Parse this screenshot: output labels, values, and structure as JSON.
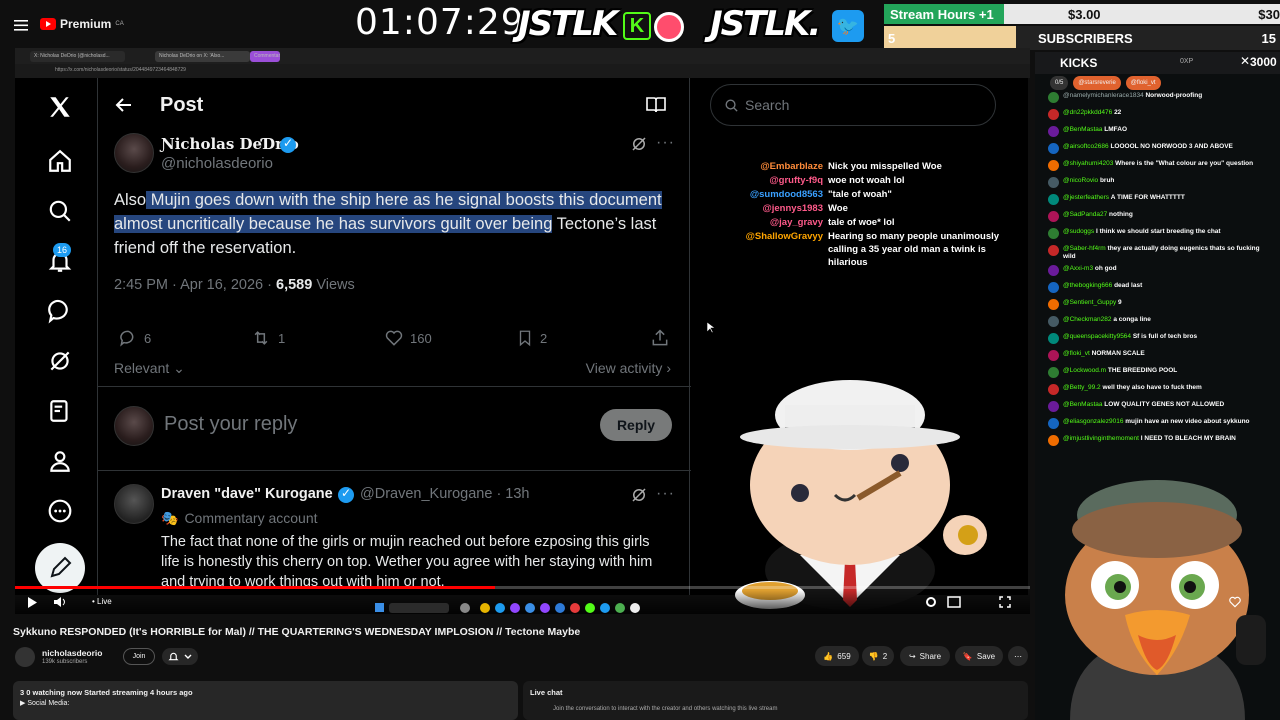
{
  "youtube": {
    "logo_text": "Premium",
    "logo_country": "CA",
    "video_title": "Sykkuno RESPONDED (It's HORRIBLE for Mal) // THE QUARTERING'S WEDNESDAY IMPLOSION // Tectone Maybe",
    "channel_name": "nicholasdeorio",
    "channel_subs": "139k subscribers",
    "join_label": "Join",
    "likes": "659",
    "dislikes": "2",
    "share_label": "Share",
    "save_label": "Save",
    "desc_line1": "3 0 watching now  Started streaming 4 hours ago",
    "desc_line2": "▶ Social Media:",
    "live_chat_label": "Live chat",
    "live_chat_sub": "Join the conversation to interact with the creator and others watching this live stream",
    "live_label": "• Live"
  },
  "overlay": {
    "timer": "01:07:29",
    "jstlk1": "JSTLK",
    "jstlk2": "JSTLK.",
    "kick_letter": "K",
    "stream_hours_label": "Stream Hours +1",
    "stream_hours_v1": "$3.00",
    "stream_hours_v2": "$30",
    "subs_count": "5",
    "subs_label": "SUBSCRIBERS",
    "subs_total": "15",
    "kicks_bar_value": "1000",
    "kicks_label": "KICKS",
    "kicks_total": "3000",
    "kicks_xp": "0XP"
  },
  "browser": {
    "tabs": [
      "X: Nicholas DeDrio (@nicholasd...",
      "Nicholas DeDrio on X: 'Also...",
      "Commentary"
    ],
    "url": "https://x.com/nicholasdeorio/status/2044849723464848729"
  },
  "x": {
    "page_title": "Post",
    "author_name": "Ɲicholas DeƊrio",
    "author_handle": "@nicholasdeorio",
    "tweet_pre": "Also",
    "tweet_highlight": " Mujin goes down with the ship here as he signal boosts this document almost uncritically because he has survivors guilt over being",
    "tweet_post": " Tectone’s last friend off the reservation.",
    "meta_time": "2:45 PM · Apr 16, 2026 · ",
    "meta_views": "6,589",
    "meta_views_label": " Views",
    "replies": "6",
    "reposts": "1",
    "likes": "160",
    "bookmarks": "2",
    "relevant": "Relevant",
    "view_activity": "View activity",
    "reply_placeholder": "Post your reply",
    "reply_button": "Reply",
    "notif_badge": "16",
    "search_placeholder": "Search",
    "reply_author": "Draven \"dave\" Kurogane",
    "reply_handle": "@Draven_Kurogane · 13h",
    "reply_label": "Commentary account",
    "reply_text": "The fact that none of the girls or mujin reached out before ezposing this girls life is honestly this cherry on top. Wether you agree with her staying with him and trying to work things out with him or not."
  },
  "overlay_chat": [
    {
      "user": "@Embarblaze",
      "msg": "Nick you misspelled Woe",
      "color": "#ff8c3a"
    },
    {
      "user": "@grufty-f9q",
      "msg": "woe not woah lol",
      "color": "#ff5a8a"
    },
    {
      "user": "@sumdood8563",
      "msg": "\"tale of woah\"",
      "color": "#3aa0ff"
    },
    {
      "user": "@jennys1983",
      "msg": "Woe",
      "color": "#ff5a8a"
    },
    {
      "user": "@jay_gravy",
      "msg": "tale of woe* lol",
      "color": "#ff5a8a"
    },
    {
      "user": "@ShallowGravyy",
      "msg": "Hearing so many people unanimously calling a 35 year old man a twink is hilarious",
      "color": "#ffa500"
    }
  ],
  "kick_chat": {
    "pins": [
      "0/5",
      "@starsreverie",
      "@floki_vt"
    ],
    "messages": [
      {
        "user": "@namelymichanlerace1834",
        "msg": "Norwood-proofing",
        "color": "#9aa"
      },
      {
        "user": "@dn22pkkdd476",
        "msg": "22",
        "color": "#53fc18"
      },
      {
        "user": "@BenMastaa",
        "msg": "LMFAO",
        "color": "#53fc18"
      },
      {
        "user": "@airsoftco2686",
        "msg": "LOOOOL NO NORWOOD 3 AND ABOVE",
        "color": "#53fc18"
      },
      {
        "user": "@shiyahumi4203",
        "msg": "Where is the \"What colour are you\" question",
        "color": "#53fc18"
      },
      {
        "user": "@nicoRovio",
        "msg": "bruh",
        "color": "#53fc18"
      },
      {
        "user": "@jesterfeathers",
        "msg": "A TIME FOR WHATTTTT",
        "color": "#53fc18"
      },
      {
        "user": "@SadPanda27",
        "msg": "nothing",
        "color": "#53fc18"
      },
      {
        "user": "@sudoggs",
        "msg": "I think we should start breeding the chat",
        "color": "#53fc18"
      },
      {
        "user": "@Saber-hf4rm",
        "msg": "they are actually doing eugenics thats so fucking wild",
        "color": "#53fc18"
      },
      {
        "user": "@Axxi-m3",
        "msg": "oh god",
        "color": "#53fc18"
      },
      {
        "user": "@thebogking666",
        "msg": "dead last",
        "color": "#53fc18"
      },
      {
        "user": "@Sentient_Guppy",
        "msg": "9",
        "color": "#53fc18"
      },
      {
        "user": "@Checkman282",
        "msg": "a conga line",
        "color": "#53fc18"
      },
      {
        "user": "@queenspacekitty9564",
        "msg": "Sf is full of tech bros",
        "color": "#53fc18"
      },
      {
        "user": "@floki_vt",
        "msg": "NORMAN SCALE",
        "color": "#53fc18"
      },
      {
        "user": "@Lockwood.m",
        "msg": "THE BREEDING POOL",
        "color": "#53fc18"
      },
      {
        "user": "@Betty_99.2",
        "msg": "well they also have to fuck them",
        "color": "#53fc18"
      },
      {
        "user": "@BenMastaa",
        "msg": "LOW QUALITY GENES NOT ALLOWED",
        "color": "#53fc18"
      },
      {
        "user": "@eliasgonzalez9016",
        "msg": "mujin have an new video about sykkuno",
        "color": "#53fc18"
      },
      {
        "user": "@imjustlivinginthemoment",
        "msg": "I NEED TO BLEACH MY BRAIN",
        "color": "#53fc18"
      }
    ]
  }
}
